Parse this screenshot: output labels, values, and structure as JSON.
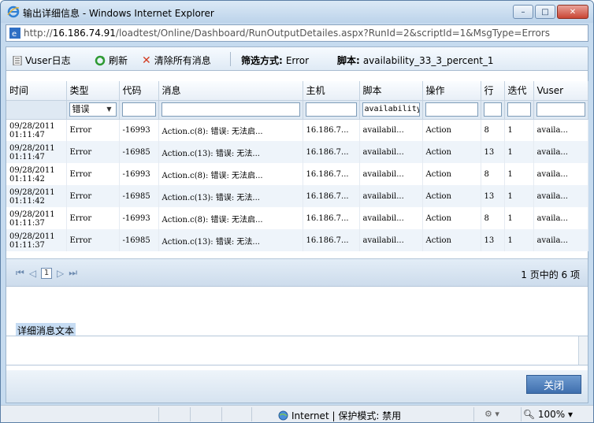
{
  "window": {
    "title": "输出详细信息 - Windows Internet Explorer",
    "minimize": "–",
    "maximize": "□",
    "close": "✕"
  },
  "address": {
    "url_prefix": "http://",
    "url_host": "16.186.74.91",
    "url_path": "/loadtest/Online/Dashboard/RunOutputDetailes.aspx?RunId=2&scriptId=1&MsgType=Errors"
  },
  "toolbar": {
    "vuser_log": "Vuser日志",
    "refresh": "刷新",
    "clear_all": "清除所有消息",
    "filter_label": "筛选方式:",
    "filter_value": "Error",
    "script_label": "脚本:",
    "script_value": "availability_33_3_percent_1"
  },
  "grid": {
    "headers": [
      "时间",
      "类型",
      "代码",
      "消息",
      "主机",
      "脚本",
      "操作",
      "行",
      "迭代",
      "Vuser"
    ],
    "filter": {
      "type_selected": "错误",
      "script_value": "availability"
    },
    "rows": [
      {
        "time": "09/28/2011 01:11:47",
        "type": "Error",
        "code": "-16993",
        "message": "Action.c(8): 错误: 无法启...",
        "host": "16.186.7...",
        "script": "availabil...",
        "action": "Action",
        "line": "8",
        "iteration": "1",
        "vuser": "availa..."
      },
      {
        "time": "09/28/2011 01:11:47",
        "type": "Error",
        "code": "-16985",
        "message": "Action.c(13): 错误: 无法...",
        "host": "16.186.7...",
        "script": "availabil...",
        "action": "Action",
        "line": "13",
        "iteration": "1",
        "vuser": "availa..."
      },
      {
        "time": "09/28/2011 01:11:42",
        "type": "Error",
        "code": "-16993",
        "message": "Action.c(8): 错误: 无法启...",
        "host": "16.186.7...",
        "script": "availabil...",
        "action": "Action",
        "line": "8",
        "iteration": "1",
        "vuser": "availa..."
      },
      {
        "time": "09/28/2011 01:11:42",
        "type": "Error",
        "code": "-16985",
        "message": "Action.c(13): 错误: 无法...",
        "host": "16.186.7...",
        "script": "availabil...",
        "action": "Action",
        "line": "13",
        "iteration": "1",
        "vuser": "availa..."
      },
      {
        "time": "09/28/2011 01:11:37",
        "type": "Error",
        "code": "-16993",
        "message": "Action.c(8): 错误: 无法启...",
        "host": "16.186.7...",
        "script": "availabil...",
        "action": "Action",
        "line": "8",
        "iteration": "1",
        "vuser": "availa..."
      },
      {
        "time": "09/28/2011 01:11:37",
        "type": "Error",
        "code": "-16985",
        "message": "Action.c(13): 错误: 无法...",
        "host": "16.186.7...",
        "script": "availabil...",
        "action": "Action",
        "line": "13",
        "iteration": "1",
        "vuser": "availa..."
      }
    ]
  },
  "pager": {
    "current_page": "1",
    "summary": "1 页中的 6 项"
  },
  "detail": {
    "label": "详细消息文本"
  },
  "footer": {
    "close_label": "关闭"
  },
  "status": {
    "zone": "Internet | 保护模式: 禁用",
    "zoom": "100%"
  }
}
